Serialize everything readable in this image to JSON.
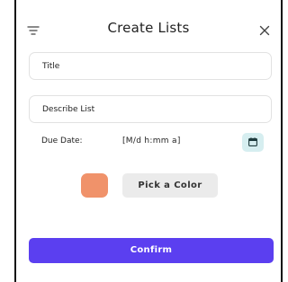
{
  "dialog": {
    "title": "Create Lists",
    "menu_icon": "filter-lines-icon",
    "close_icon": "close-icon"
  },
  "form": {
    "title_placeholder": "Title",
    "description_placeholder": "Describe List",
    "due_date_label": "Due Date:",
    "due_date_value": "[M/d h:mm a]",
    "calendar_icon": "calendar-icon",
    "selected_color": "#f0926a",
    "pick_color_label": "Pick a Color",
    "confirm_label": "Confirm"
  },
  "colors": {
    "accent": "#5b3ff0",
    "calendar_bg": "#d6eef0",
    "pick_button_bg": "#ebebeb"
  }
}
